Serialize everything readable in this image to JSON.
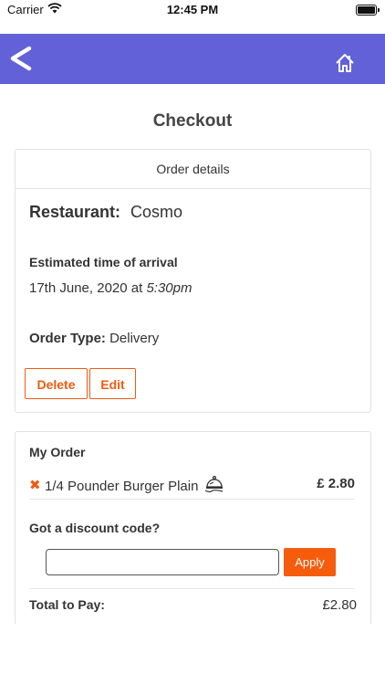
{
  "status_bar": {
    "carrier": "Carrier",
    "time": "12:45 PM"
  },
  "nav_bar": {
    "back_icon": "back-chevron-icon",
    "home_icon": "home-icon",
    "background": "#6261d8"
  },
  "page": {
    "title": "Checkout"
  },
  "order_details": {
    "header": "Order details",
    "restaurant_label": "Restaurant:",
    "restaurant_name": "Cosmo",
    "eta_label": "Estimated time of arrival",
    "eta_date": "17th June, 2020 at",
    "eta_time": "5:30pm",
    "order_type_label": "Order Type:",
    "order_type_value": "Delivery",
    "delete_label": "Delete",
    "edit_label": "Edit"
  },
  "my_order": {
    "title": "My Order",
    "items": [
      {
        "name": "1/4 Pounder Burger Plain",
        "price": "£ 2.80",
        "remove_icon": "remove-x-icon",
        "service_icon": "cloche-icon"
      }
    ],
    "discount_label": "Got a discount code?",
    "discount_value": "",
    "apply_label": "Apply",
    "total_label": "Total to Pay:",
    "total_value": "£2.80"
  },
  "colors": {
    "accent": "#f05a12",
    "nav": "#6261d8"
  }
}
